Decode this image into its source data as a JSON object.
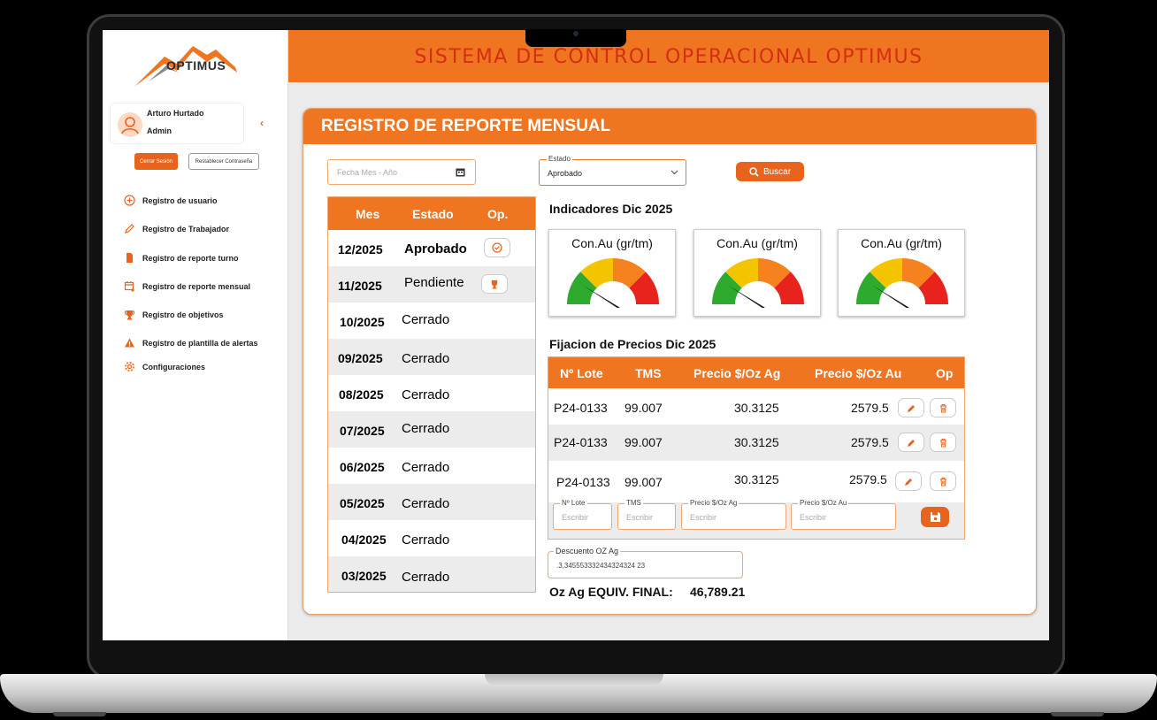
{
  "app": {
    "header_title": "SISTEMA DE CONTROL OPERACIONAL OPTIMUS",
    "logo_text": "OPTIMUS"
  },
  "sidebar": {
    "user_name": "Arturo Hurtado",
    "user_role": "Admin",
    "logout_label": "Cerrar Sesión",
    "reset_label": "Restablecer Contraseña",
    "items": [
      {
        "label": "Registro de usuario",
        "icon": "plus-circle-icon"
      },
      {
        "label": "Registro de Trabajador",
        "icon": "pencil-icon"
      },
      {
        "label": "Registro de reporte turno",
        "icon": "document-icon"
      },
      {
        "label": "Registro de reporte mensual",
        "icon": "calendar-add-icon"
      },
      {
        "label": "Registro de objetivos",
        "icon": "trophy-icon"
      },
      {
        "label": "Registro de plantilla de alertas",
        "icon": "warning-icon"
      },
      {
        "label": "Configuraciones",
        "icon": "gear-icon"
      }
    ]
  },
  "panel": {
    "title": "REGISTRO DE REPORTE MENSUAL",
    "date_placeholder": "Fecha Mes - Año",
    "estado_label": "Estado",
    "estado_value": "Aprobado",
    "search_label": "Buscar"
  },
  "months_table": {
    "headers": [
      "Mes",
      "Estado",
      "Op."
    ],
    "rows": [
      {
        "mes": "12/2025",
        "estado": "Aprobado",
        "op": "check-circle-icon"
      },
      {
        "mes": "11/2025",
        "estado": "Pendiente",
        "op": "trophy-icon"
      },
      {
        "mes": "10/2025",
        "estado": "Cerrado",
        "op": ""
      },
      {
        "mes": "09/2025",
        "estado": "Cerrado",
        "op": ""
      },
      {
        "mes": "08/2025",
        "estado": "Cerrado",
        "op": ""
      },
      {
        "mes": "07/2025",
        "estado": "Cerrado",
        "op": ""
      },
      {
        "mes": "06/2025",
        "estado": "Cerrado",
        "op": ""
      },
      {
        "mes": "05/2025",
        "estado": "Cerrado",
        "op": ""
      },
      {
        "mes": "04/2025",
        "estado": "Cerrado",
        "op": ""
      },
      {
        "mes": "03/2025",
        "estado": "Cerrado",
        "op": ""
      }
    ]
  },
  "indicators": {
    "title": "Indicadores Dic 2025",
    "gauges": [
      {
        "label": "Con.Au (gr/tm)",
        "level": 0.18
      },
      {
        "label": "Con.Au (gr/tm)",
        "level": 0.18
      },
      {
        "label": "Con.Au (gr/tm)",
        "level": 0.18
      }
    ],
    "colors": [
      "#2eaa2e",
      "#f5c400",
      "#f5821e",
      "#e8231d"
    ]
  },
  "prices": {
    "title": "Fijacion de Precios Dic 2025",
    "headers": [
      "Nº Lote",
      "TMS",
      "Precio $/Oz Ag",
      "Precio $/Oz Au",
      "Op"
    ],
    "rows": [
      {
        "lote": "P24-0133",
        "tms": "99.007",
        "ag": "30.3125",
        "au": "2579.5"
      },
      {
        "lote": "P24-0133",
        "tms": "99.007",
        "ag": "30.3125",
        "au": "2579.5"
      },
      {
        "lote": "P24-0133",
        "tms": "99.007",
        "ag": "30.3125",
        "au": "2579.5"
      }
    ],
    "new_row": {
      "labels": [
        "Nº Lote",
        "TMS",
        "Precio $/Oz Ag",
        "Precio $/Oz Au"
      ],
      "placeholder": "Escribir"
    }
  },
  "discount": {
    "label": "Descuento OZ Ag",
    "value": ".3,345553332434324324 23"
  },
  "final": {
    "label": "Oz Ag EQUIV. FINAL:",
    "value": "46,789.21"
  },
  "accent_color": "#f07520"
}
